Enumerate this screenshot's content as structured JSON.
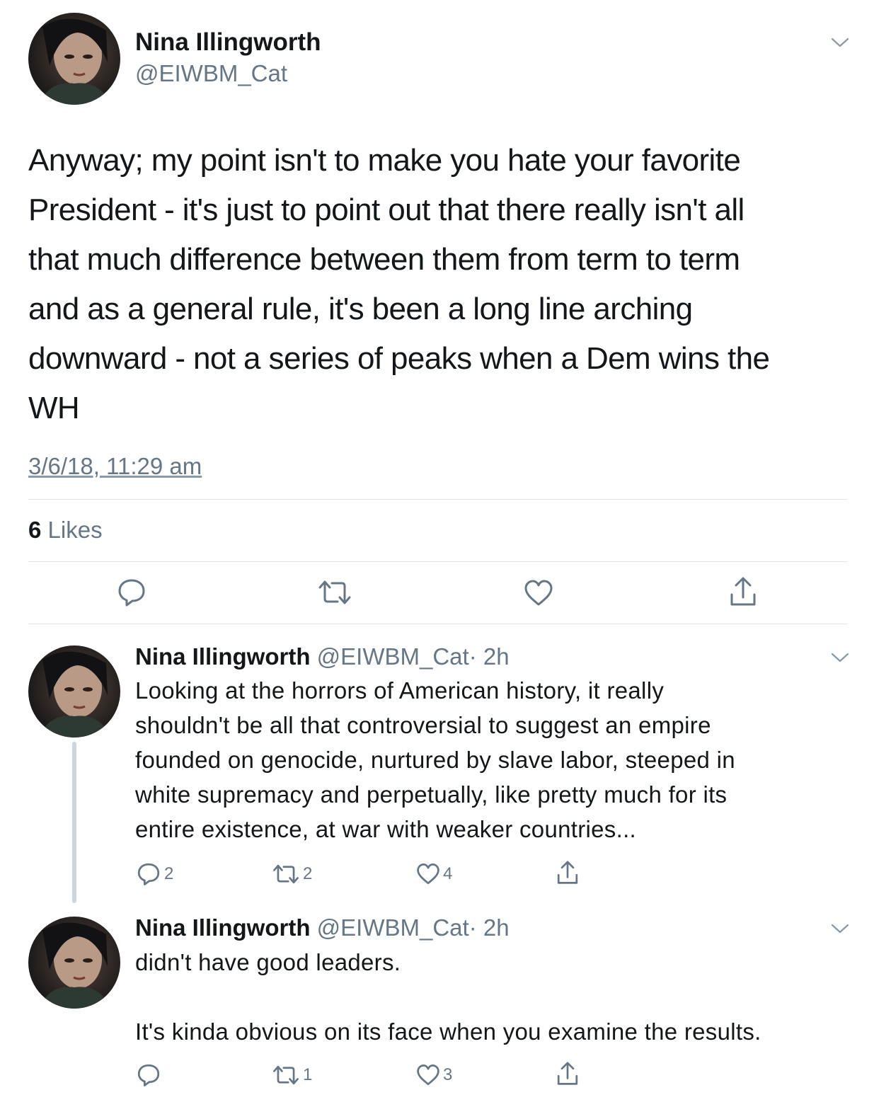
{
  "main_tweet": {
    "author_name": "Nina Illingworth",
    "author_handle": "@EIWBM_Cat",
    "avatar_icon": "avatar-icon",
    "text_lines": [
      "Anyway; my point isn't to make you hate your favorite",
      "President - it's just to point out that there really isn't all",
      "that much difference between them from term to term",
      "and as a general rule, it's been a long line arching",
      "downward - not a series of peaks when a Dem wins the",
      "WH"
    ],
    "timestamp": "3/6/18, 11:29 am",
    "likes_count": "6",
    "likes_label": "Likes",
    "actions": [
      "reply-icon",
      "retweet-icon",
      "like-icon",
      "share-icon"
    ]
  },
  "replies": [
    {
      "author_name": "Nina Illingworth",
      "author_handle": "@EIWBM_Cat",
      "time": "· 2h",
      "text_lines": [
        "Looking at the horrors of American history, it really",
        "shouldn't be all that controversial to suggest an empire",
        "founded on genocide, nurtured by slave labor, steeped in",
        "white supremacy and perpetually, like pretty much for its",
        "entire existence, at war with weaker countries..."
      ],
      "reply_count": "2",
      "retweet_count": "2",
      "like_count": "4"
    },
    {
      "author_name": "Nina Illingworth",
      "author_handle": "@EIWBM_Cat",
      "time": "· 2h",
      "text_lines": [
        "didn't have good leaders.",
        "",
        "It's kinda obvious on its face when you examine the results."
      ],
      "reply_count": "",
      "retweet_count": "1",
      "like_count": "3"
    }
  ],
  "colors": {
    "text_primary": "#14171a",
    "text_secondary": "#657786",
    "divider": "#e1e8ed",
    "thread_line": "#ccd6dd"
  }
}
